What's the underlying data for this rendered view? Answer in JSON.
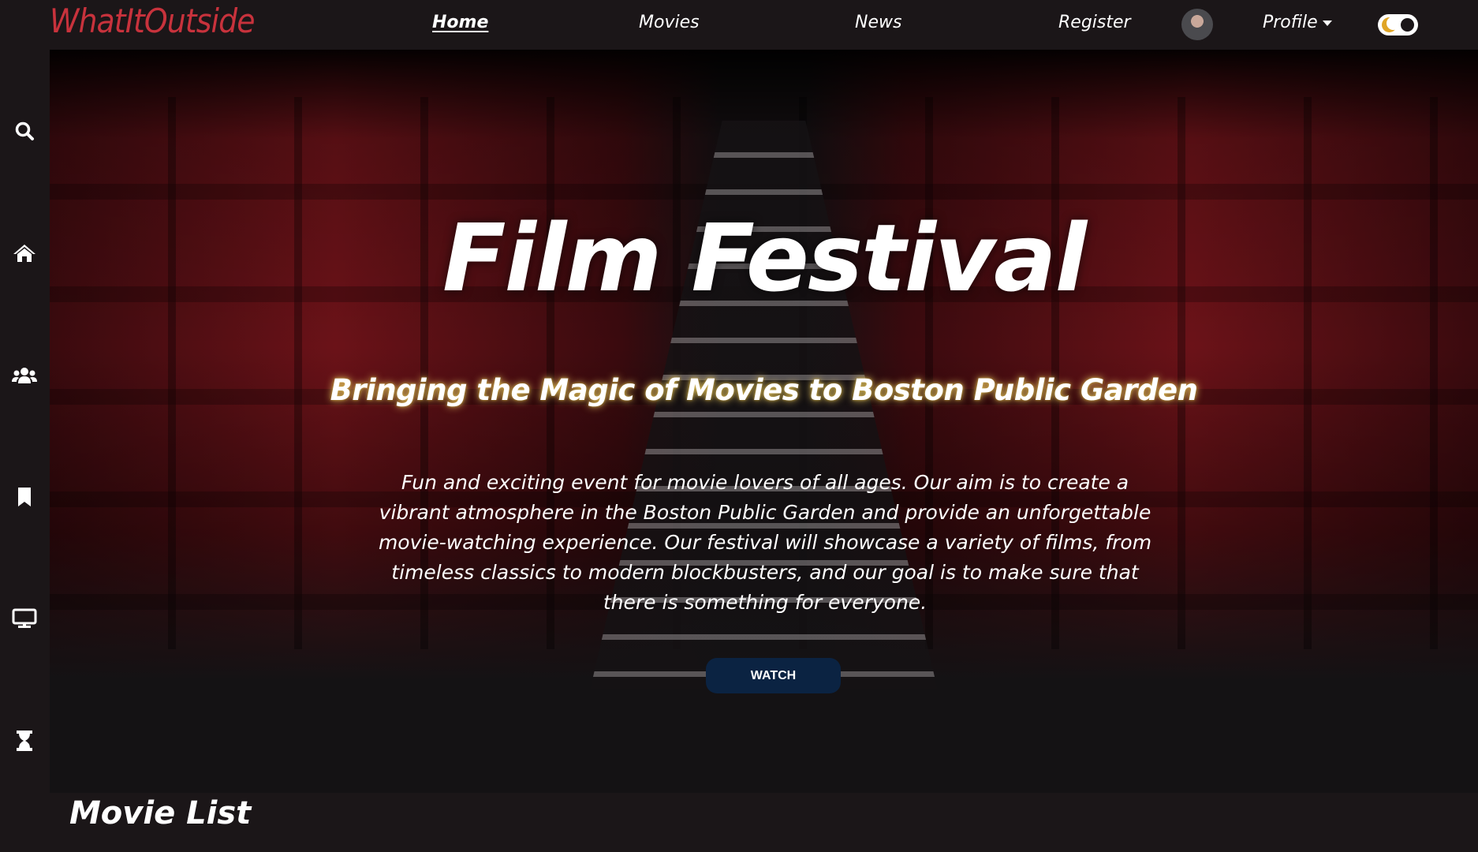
{
  "header": {
    "logo": "WhatItOutside",
    "nav": [
      {
        "label": "Home",
        "active": true
      },
      {
        "label": "Movies"
      },
      {
        "label": "News"
      },
      {
        "label": "Register"
      }
    ],
    "profile_label": "Profile",
    "theme_toggle": "dark-mode-toggle"
  },
  "sidebar": {
    "icons": [
      "search-icon",
      "home-icon",
      "users-icon",
      "bookmark-icon",
      "monitor-icon",
      "hourglass-icon"
    ]
  },
  "hero": {
    "title": "Film Festival",
    "subtitle": "Bringing the Magic of Movies to Boston Public Garden",
    "description": "Fun and exciting event for movie lovers of all ages. Our aim is to create a vibrant atmosphere in the Boston Public Garden and provide an unforgettable movie-watching experience. Our festival will showcase a variety of films, from timeless classics to modern blockbusters, and our goal is to make sure that there is something for everyone.",
    "button": "WATCH",
    "button_color": "#0b2342"
  },
  "section": {
    "title": "Movie List"
  },
  "colors": {
    "brand": "#c8323c",
    "background": "#1b1618"
  }
}
